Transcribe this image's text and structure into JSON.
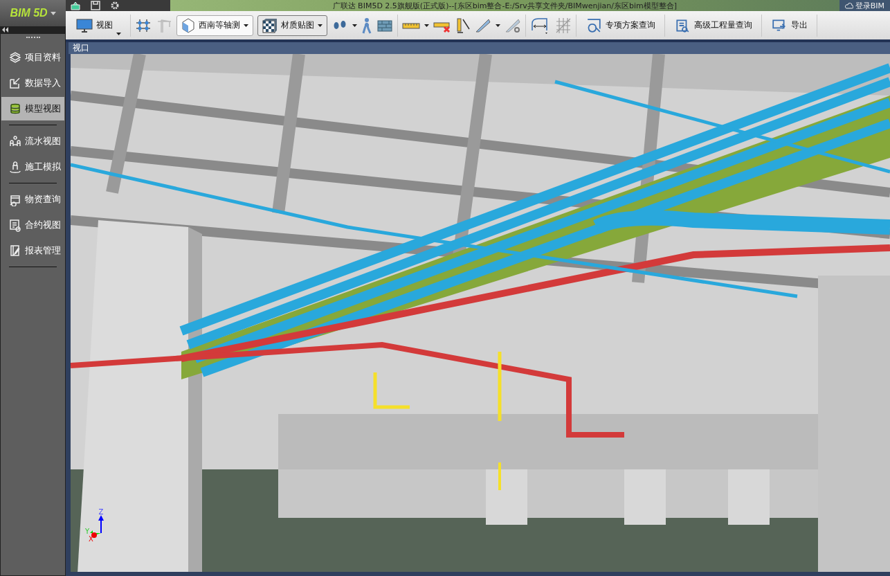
{
  "window": {
    "title": "广联达 BIM5D 2.5旗舰版(正式版)--[东区bim整合-E:/Srv共享文件夹/BIMwenjian/东区bim模型整合]",
    "login": "登录BIM"
  },
  "app_logo": "BIM 5D",
  "toolbar": {
    "view_button": "视图",
    "view_mode": "西南等轴测",
    "material_mode": "材质贴图",
    "buttons": [
      {
        "label": "专项方案查询",
        "kind": "search"
      },
      {
        "label": "高级工程量查询",
        "kind": "quantity"
      },
      {
        "label": "导出",
        "kind": "export"
      }
    ]
  },
  "sidebar": {
    "groups": [
      {
        "items": [
          {
            "label": "项目资料",
            "kind": "docs",
            "selected": false
          },
          {
            "label": "数据导入",
            "kind": "import",
            "selected": false
          },
          {
            "label": "模型视图",
            "kind": "model",
            "selected": true
          }
        ]
      },
      {
        "items": [
          {
            "label": "流水视图",
            "kind": "flow",
            "selected": false
          },
          {
            "label": "施工模拟",
            "kind": "person",
            "selected": false
          }
        ]
      },
      {
        "items": [
          {
            "label": "物资查询",
            "kind": "material",
            "selected": false
          },
          {
            "label": "合约视图",
            "kind": "contract",
            "selected": false
          },
          {
            "label": "报表管理",
            "kind": "report",
            "selected": false
          }
        ]
      }
    ]
  },
  "viewport": {
    "title": "视口",
    "axes": [
      "Z",
      "Y",
      "X"
    ]
  }
}
